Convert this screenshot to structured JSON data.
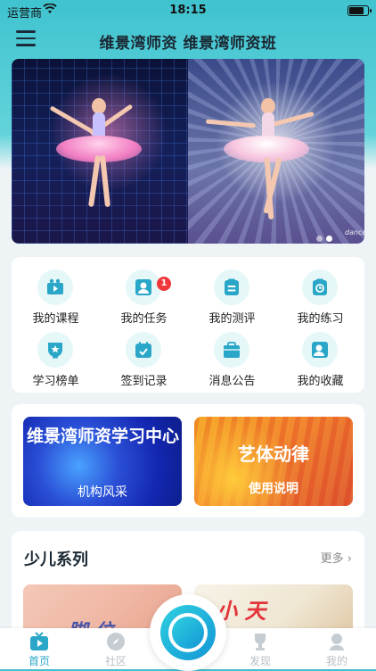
{
  "status_bar": {
    "carrier": "运营商",
    "time": "18:15"
  },
  "header": {
    "title": "维景湾师资 维景湾师资班"
  },
  "banner": {
    "watermark": "dance",
    "slide_count": 2,
    "active_slide": 2
  },
  "quick_links": [
    {
      "label": "我的课程",
      "icon": "course-video-icon"
    },
    {
      "label": "我的任务",
      "icon": "task-user-icon",
      "badge": "1"
    },
    {
      "label": "我的测评",
      "icon": "assessment-clipboard-icon"
    },
    {
      "label": "我的练习",
      "icon": "practice-clipboard-icon"
    },
    {
      "label": "学习榜单",
      "icon": "ranking-medal-icon"
    },
    {
      "label": "签到记录",
      "icon": "checkin-calendar-icon"
    },
    {
      "label": "消息公告",
      "icon": "notice-folder-icon"
    },
    {
      "label": "我的收藏",
      "icon": "favorites-user-icon"
    }
  ],
  "promos": {
    "left": {
      "title": "维景湾师资学习中心",
      "subtitle": "机构风采"
    },
    "right": {
      "title": "艺体动律",
      "subtitle": "使用说明"
    }
  },
  "series": {
    "title": "少儿系列",
    "more": "更多",
    "thumb_a_text": "脚 位",
    "thumb_b_text": "小 天"
  },
  "tabbar": {
    "items": [
      {
        "label": "首页",
        "icon": "home-play-icon",
        "active": true
      },
      {
        "label": "社区",
        "icon": "compass-icon",
        "active": false
      },
      {
        "label": "发现",
        "icon": "trophy-icon",
        "active": false
      },
      {
        "label": "我的",
        "icon": "profile-icon",
        "active": false
      }
    ]
  },
  "colors": {
    "accent": "#2aa7c8",
    "header_gradient": "#3fc3cf",
    "badge": "#f0383c"
  }
}
